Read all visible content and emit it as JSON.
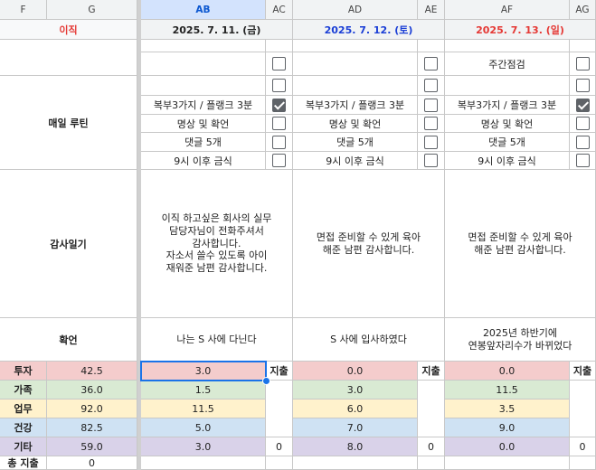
{
  "columns": [
    "F",
    "G",
    "AB",
    "AC",
    "AD",
    "AE",
    "AF",
    "AG"
  ],
  "date_row": {
    "label": "이직",
    "d1": "2025. 7. 11. (금)",
    "d2": "2025. 7. 12. (토)",
    "d3": "2025. 7. 13. (일)"
  },
  "colors": {
    "saturday": "#1a3ed6",
    "sunday": "#e53935",
    "label_red": "#e53935",
    "selection": "#1a73e8"
  },
  "top_rows": {
    "af_label": "주간점검",
    "af_checked": false
  },
  "routine": {
    "label": "매일 루틴",
    "items": [
      "복부3가지 / 플랭크 3분",
      "명상 및 확언",
      "댓글 5개",
      "9시 이후 금식"
    ],
    "checks_ab": [
      true,
      false,
      false,
      false
    ],
    "checks_ad": [
      false,
      false,
      false,
      false
    ],
    "checks_af": [
      true,
      false,
      false,
      false
    ]
  },
  "gratitude": {
    "label": "감사일기",
    "ab": "이직 하고싶은 회사의 실무\n담당자님이 전화주셔서\n감사합니다.\n자소서 쓸수 있도록 아이\n재워준 남편 감사합니다.",
    "ad": "면접 준비할 수 있게 육아\n해준 남편 감사합니다.",
    "af": "면접 준비할 수 있게 육아\n해준 남편 감사합니다."
  },
  "affirm": {
    "label": "확언",
    "ab": "나는 S 사에 다닌다",
    "ad": "S 사에 입사하였다",
    "af": "2025년 하반기에\n연봉앞자리수가 바뀌었다"
  },
  "expense": {
    "header": "지출",
    "categories": [
      {
        "name": "투자",
        "total": "42.5",
        "ab": "3.0",
        "ad": "0.0",
        "af": "0.0",
        "color": "#f4cccc"
      },
      {
        "name": "가족",
        "total": "36.0",
        "ab": "1.5",
        "ad": "3.0",
        "af": "11.5",
        "color": "#d9ead3"
      },
      {
        "name": "업무",
        "total": "92.0",
        "ab": "11.5",
        "ad": "6.0",
        "af": "3.5",
        "color": "#fff2cc"
      },
      {
        "name": "건강",
        "total": "82.5",
        "ab": "5.0",
        "ad": "7.0",
        "af": "9.0",
        "color": "#cfe2f3"
      },
      {
        "name": "기타",
        "total": "59.0",
        "ab": "3.0",
        "ad": "8.0",
        "af": "0.0",
        "color": "#d9d2e9"
      }
    ],
    "day_totals": {
      "ac": "0",
      "ae": "0",
      "ag": "0"
    },
    "total_label": "총 지출",
    "total_value": "0"
  }
}
